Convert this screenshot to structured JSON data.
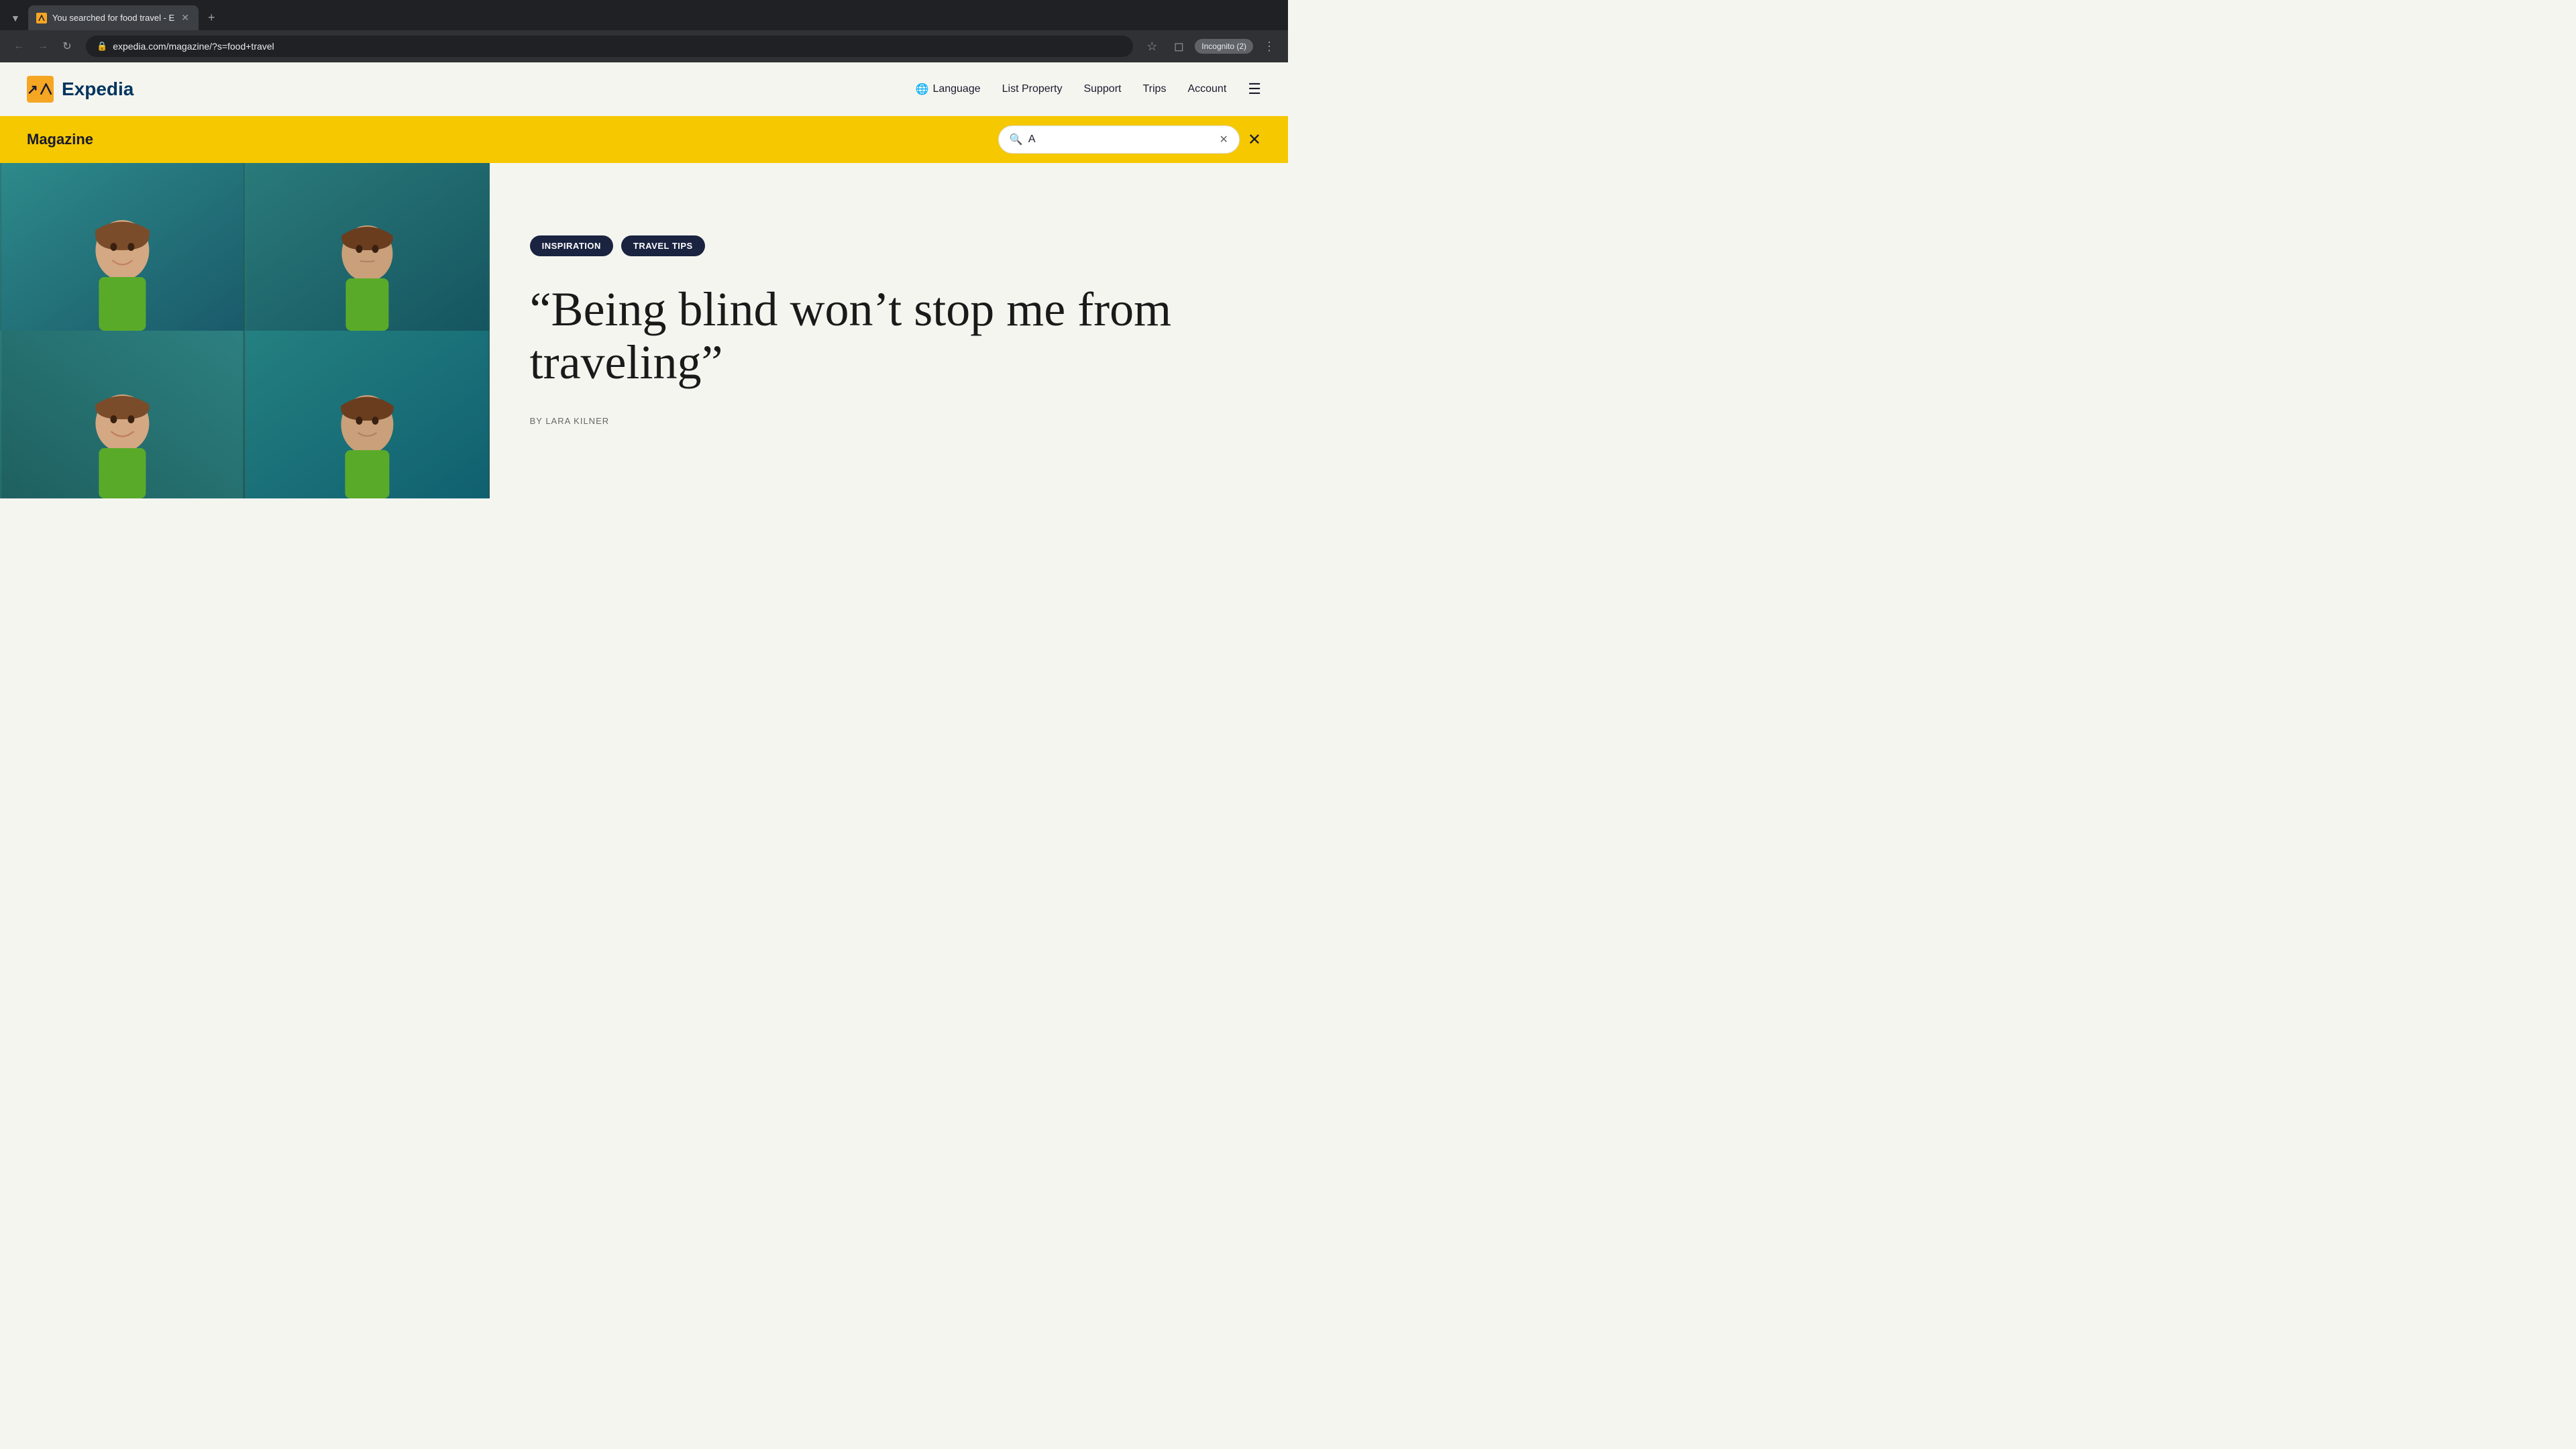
{
  "browser": {
    "tab_title": "You searched for food travel - E",
    "tab_favicon": "✈",
    "url": "expedia.com/magazine/?s=food+travel",
    "incognito_label": "Incognito (2)",
    "new_tab_label": "+"
  },
  "nav": {
    "logo_text": "Expedia",
    "language_label": "Language",
    "list_property_label": "List Property",
    "support_label": "Support",
    "trips_label": "Trips",
    "account_label": "Account"
  },
  "magazine_bar": {
    "title": "Magazine",
    "search_value": "A",
    "search_placeholder": "Search"
  },
  "article": {
    "tag1": "INSPIRATION",
    "tag2": "TRAVEL TIPS",
    "headline": "“Being blind won’t stop me from traveling”",
    "byline": "BY LARA KILNER"
  }
}
